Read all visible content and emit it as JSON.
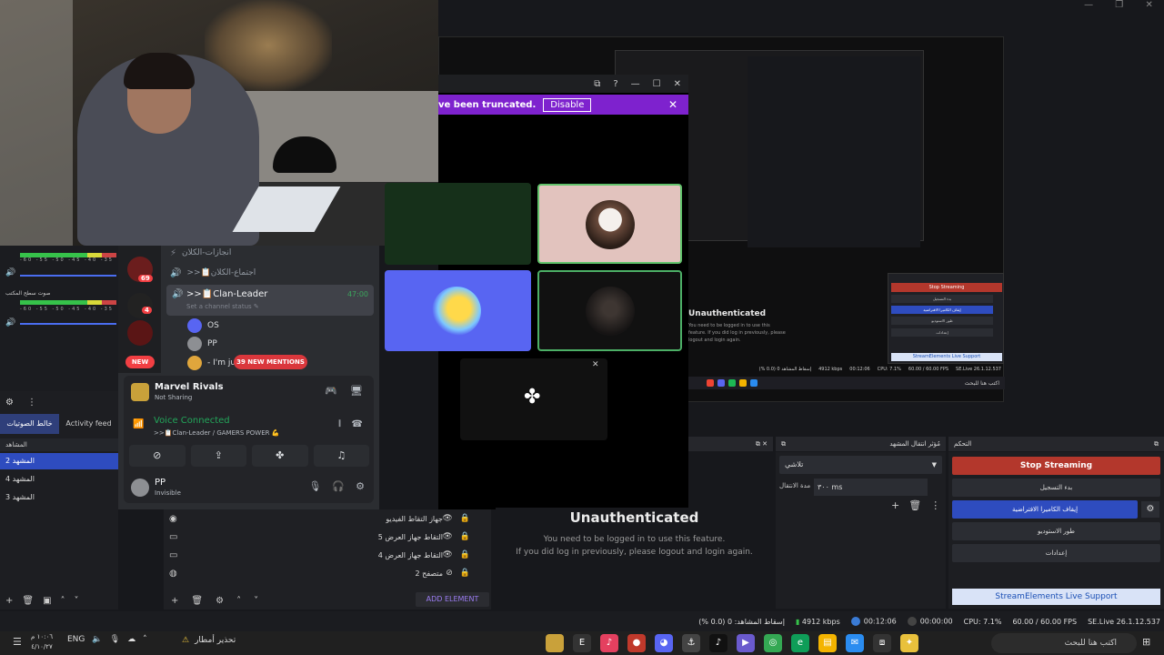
{
  "discord_popup": {
    "truncate_message": "ve been truncated.",
    "disable_label": "Disable",
    "close_glyph": "✕"
  },
  "discord": {
    "channels": [
      {
        "name": "انجازات-الكلان",
        "icon": "⚡"
      },
      {
        "name": ">>📋اجتماع-الكلان",
        "icon": "🔊"
      }
    ],
    "active_channel": {
      "name": ">>📋Clan-Leader",
      "status": "Set a channel status ✎",
      "time": "47:00"
    },
    "voice_users": [
      {
        "name": "OS",
        "color": "#5865f2"
      },
      {
        "name": "PP",
        "color": "#8d8f93"
      },
      {
        "name": "- I'm ju",
        "color": "#e0a63c"
      }
    ],
    "server_badges": {
      "badge1": "69",
      "badge2": "4"
    },
    "new_label": "NEW",
    "mentions_label": "39 NEW MENTIONS",
    "activity": {
      "game": "Marvel Rivals",
      "sub": "Not Sharing"
    },
    "voice": {
      "status": "Voice Connected",
      "channel": ">>📋Clan-Leader / GAMERS POWER 💪"
    },
    "user": {
      "name": "PP",
      "status": "Invisible"
    }
  },
  "mixer": {
    "tracks": [
      {
        "label": "",
        "scale": "-60 -55 -50 -45 -40 -35"
      },
      {
        "label": "صوت سطح المكتب",
        "scale": "-60 -55 -50 -45 -40 -35"
      }
    ]
  },
  "scenes": {
    "tabs": [
      "خالط الصوتيات",
      "Activity feed"
    ],
    "header": "المشاهد",
    "items": [
      "المشهد 2",
      "المشهد 4",
      "المشهد 3"
    ]
  },
  "sources": {
    "items": [
      {
        "name": "جهاز التقاط الفيديو",
        "icon": "📷"
      },
      {
        "name": "التقاط جهاز العرض 5",
        "icon": "▢"
      },
      {
        "name": "التقاط جهاز العرض 4",
        "icon": "▢"
      },
      {
        "name": "متصفح 2",
        "icon": "🌐"
      }
    ],
    "add_element": "ADD ELEMENT"
  },
  "main_preview": {
    "title": "Unauthenticated",
    "line1": "You need to be logged in to use this feature.",
    "line2": "If you did log in previously, please logout and login again."
  },
  "transitions": {
    "header": "مُؤثر انتقال المشهد",
    "selected": "تلاشي",
    "duration_label": "مدة الانتقال",
    "duration": "٣٠٠ ms"
  },
  "controls": {
    "header": "التحكم",
    "stop_streaming": "Stop Streaming",
    "start_recording": "بدء التسجيل",
    "stop_virtual_cam": "إيقاف الكاميرا الافتراضية",
    "studio_mode": "طور الاستوديو",
    "settings": "إعدادات",
    "support": "StreamElements Live Support"
  },
  "status": {
    "dropped": "إسقاط المشاهد: 0 (0.0 %)",
    "bitrate": "4912 kbps",
    "live_time": "00:12:06",
    "rec_time": "00:00:00",
    "cpu": "CPU: 7.1%",
    "fps": "60.00 / 60.00 FPS",
    "version": "SE.Live 26.1.12.537"
  },
  "nested": {
    "unauth_title": "Unauthenticated",
    "unauth_sub": "You need to be logged in to use this feature. If you did log in previously, please logout and login again.",
    "stop": "Stop Streaming",
    "btns": [
      "بدء التسجيل",
      "إيقاف الكاميرا الافتراضية",
      "طور الاستوديو",
      "إعدادات"
    ],
    "support": "StreamElements Live Support",
    "status": [
      "إسقاط المشاهد 0 (0.0 %)",
      "4912 kbps",
      "00:12:06",
      "CPU: 7.1%",
      "60.00 / 60.00 FPS",
      "SE.Live 26.1.12.537"
    ],
    "search": "اكتب هنا للبحث"
  },
  "taskbar": {
    "search": "اكتب هنا للبحث",
    "weather": "تحذير أمطار",
    "lang": "ENG",
    "time": "١٠:٠٦ م",
    "date": "٤/١٠/٢٧"
  },
  "colors": {
    "accent": "#2e4cbf",
    "stop": "#b3372c",
    "discord_green": "#23a55a",
    "purple_bar": "#7e22ce"
  }
}
